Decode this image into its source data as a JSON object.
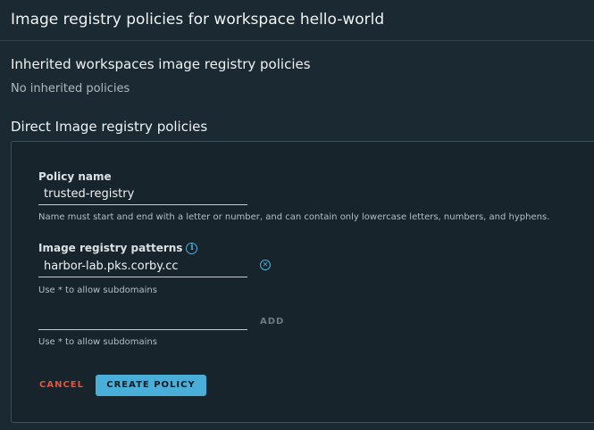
{
  "header": {
    "title": "Image registry policies for workspace hello-world"
  },
  "inherited": {
    "title": "Inherited workspaces image registry policies",
    "empty_text": "No inherited policies"
  },
  "direct": {
    "title": "Direct Image registry policies",
    "form": {
      "policy_name_label": "Policy name",
      "policy_name_value": "trusted-registry",
      "policy_name_help": "Name must start and end with a letter or number, and can contain only lowercase letters, numbers, and hyphens.",
      "patterns_label": "Image registry patterns",
      "pattern_value": "harbor-lab.pks.corby.cc",
      "pattern_help": "Use * to allow subdomains",
      "new_pattern_value": "",
      "new_pattern_help": "Use * to allow subdomains",
      "add_label": "ADD",
      "cancel_label": "CANCEL",
      "create_label": "CREATE POLICY"
    }
  },
  "colors": {
    "background": "#1b2a32",
    "accent": "#49afd9",
    "danger": "#e2543c"
  }
}
